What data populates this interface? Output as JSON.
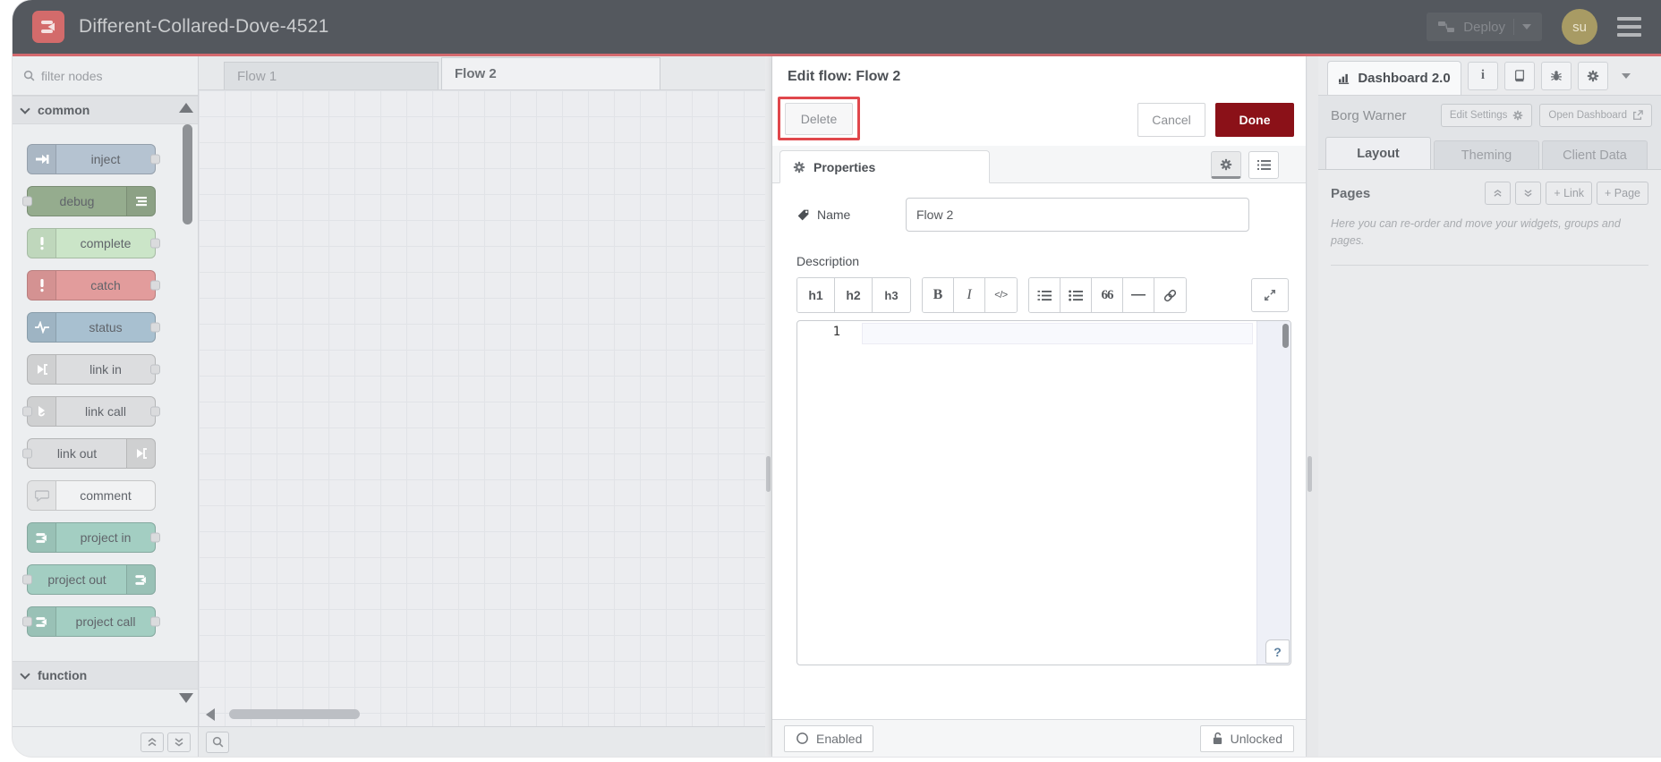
{
  "header": {
    "title": "Different-Collared-Dove-4521",
    "deploy": {
      "label": "Deploy"
    },
    "avatar": {
      "initials": "su"
    }
  },
  "palette": {
    "filter_placeholder": "filter nodes",
    "sections": {
      "common": "common",
      "function": "function"
    },
    "nodes": [
      {
        "label": "inject",
        "color": "#b5c3d1"
      },
      {
        "label": "debug",
        "color": "#95ac8e"
      },
      {
        "label": "complete",
        "color": "#cbe5c8"
      },
      {
        "label": "catch",
        "color": "#e29c9c"
      },
      {
        "label": "status",
        "color": "#a8c0d0"
      },
      {
        "label": "link in",
        "color": "#dcdddf"
      },
      {
        "label": "link call",
        "color": "#dcdddf"
      },
      {
        "label": "link out",
        "color": "#dcdddf"
      },
      {
        "label": "comment",
        "color": "#f1f2f3"
      },
      {
        "label": "project in",
        "color": "#a3cec2"
      },
      {
        "label": "project out",
        "color": "#a3cec2"
      },
      {
        "label": "project call",
        "color": "#a3cec2"
      }
    ]
  },
  "workspace": {
    "tabs": [
      {
        "label": "Flow 1"
      },
      {
        "label": "Flow 2"
      }
    ]
  },
  "tray": {
    "title": "Edit flow: Flow 2",
    "delete_label": "Delete",
    "cancel_label": "Cancel",
    "done_label": "Done",
    "properties_tab": "Properties",
    "name_label": "Name",
    "name_value": "Flow 2",
    "description_label": "Description",
    "md_toolbar": {
      "h1": "h1",
      "h2": "h2",
      "h3": "h3",
      "bold": "B",
      "italic": "I",
      "code": "</>",
      "quote": "66",
      "hr": "—"
    },
    "editor": {
      "line_number": "1",
      "help_button": "?"
    },
    "footer": {
      "enabled_label": "Enabled",
      "locked_label": "Unlocked"
    },
    "annotation_color": "#e0474c"
  },
  "sidebar": {
    "dashboard_tab": "Dashboard 2.0",
    "owner": "Borg Warner",
    "edit_settings_label": "Edit Settings",
    "open_dashboard_label": "Open Dashboard",
    "tabs": [
      {
        "label": "Layout"
      },
      {
        "label": "Theming"
      },
      {
        "label": "Client Data"
      }
    ],
    "pages": {
      "title": "Pages",
      "link_button": "+ Link",
      "page_button": "+ Page",
      "help_text": "Here you can re-order and move your widgets, groups and pages."
    }
  }
}
